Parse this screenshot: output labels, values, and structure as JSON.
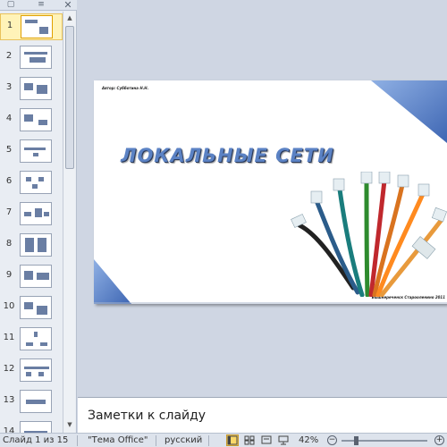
{
  "left_panel": {
    "thumbnails": [
      "1",
      "2",
      "3",
      "4",
      "5",
      "6",
      "7",
      "8",
      "9",
      "10",
      "11",
      "12",
      "13",
      "14"
    ],
    "active_index": 0
  },
  "slide": {
    "author_line": "Автор: Субботина Н.Н.",
    "title": "ЛОКАЛЬНЫЕ СЕТИ",
    "footer_line": "Вышнереченск  Старооленино  2011"
  },
  "notes": {
    "placeholder": "Заметки к слайду"
  },
  "status_bar": {
    "slide_counter": "Слайд 1 из 15",
    "theme": "\"Тема Office\"",
    "language": "русский",
    "zoom": "42%"
  },
  "colors": {
    "accent_blue": "#5b82c4",
    "active_thumb": "#fff3b8",
    "slide_corner": "#4a74c0"
  }
}
